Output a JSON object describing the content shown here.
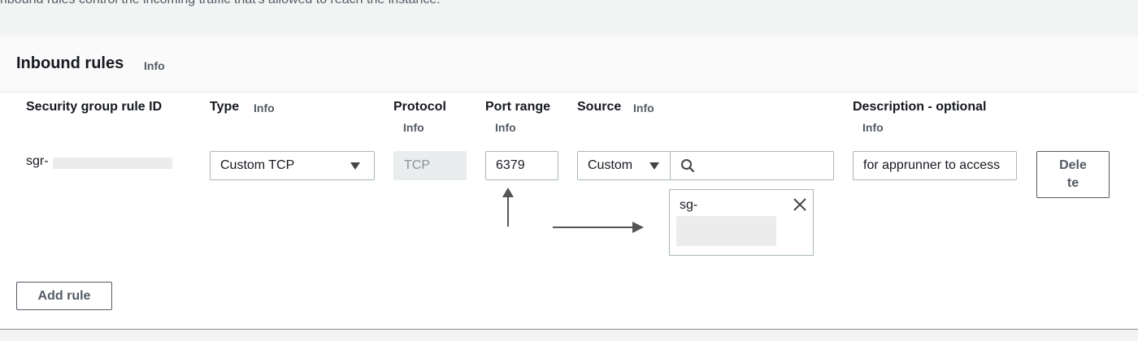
{
  "page": {
    "description": "nbound rules control the incoming traffic that's allowed to reach the instance."
  },
  "panel": {
    "title": "Inbound rules",
    "info": "Info"
  },
  "columns": {
    "rule_id": "Security group rule ID",
    "type": "Type",
    "type_info": "Info",
    "protocol": "Protocol",
    "protocol_info": "Info",
    "port_range": "Port range",
    "port_range_info": "Info",
    "source": "Source",
    "source_info": "Info",
    "description": "Description - optional",
    "description_info": "Info"
  },
  "rule": {
    "rule_id_prefix": "sgr-",
    "type_value": "Custom TCP",
    "protocol_value": "TCP",
    "port_range_value": "6379",
    "source_type_value": "Custom",
    "source_search_value": "",
    "source_token_prefix": "sg-",
    "description_value": "for apprunner to access",
    "delete_label_line1": "Dele",
    "delete_label_line2": "te"
  },
  "actions": {
    "add_rule_label": "Add rule"
  },
  "icons": {
    "type_dropdown": "caret-down-icon",
    "source_dropdown": "caret-down-icon",
    "search": "search-icon",
    "token_remove": "close-icon",
    "annotation_up": "arrow-up-icon",
    "annotation_right": "arrow-right-icon"
  },
  "colors": {
    "panel_bg": "#ffffff",
    "page_bg": "#f2f3f3",
    "text": "#16191f",
    "muted": "#545b64",
    "border": "#aab7b8"
  }
}
